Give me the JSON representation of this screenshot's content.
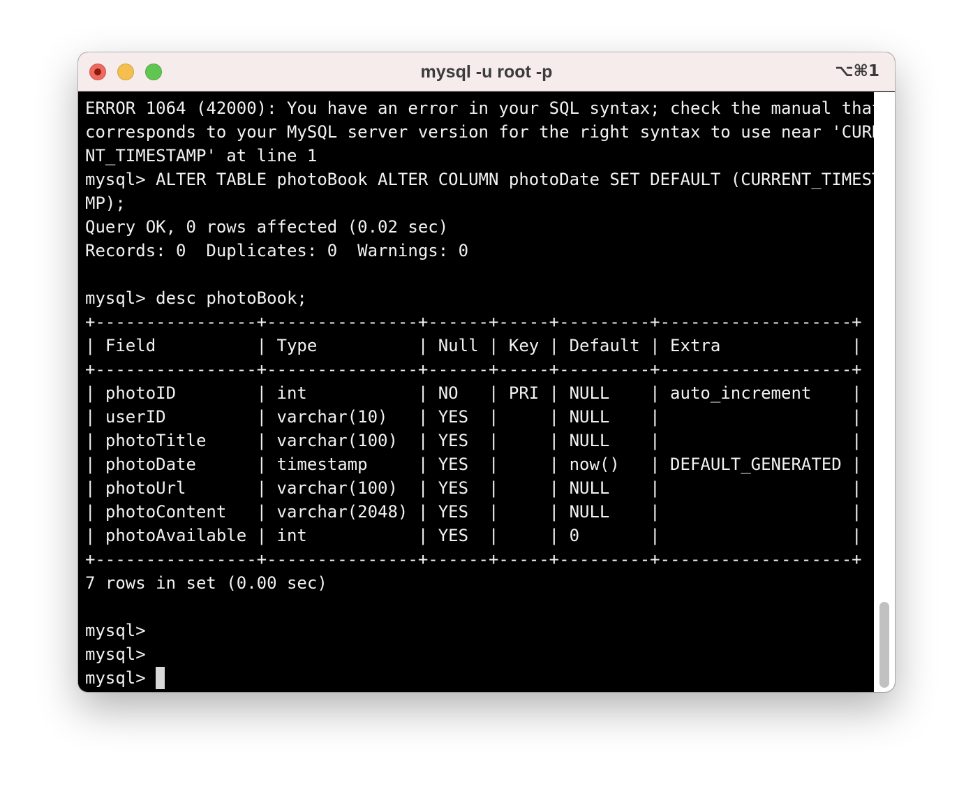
{
  "window": {
    "title": "mysql -u root -p",
    "shortcut": "⌥⌘1",
    "traffic_lights": {
      "close": "#ed6a5e",
      "minimize": "#f5bf4f",
      "zoom": "#61c554"
    }
  },
  "terminal": {
    "background": "#000000",
    "foreground": "#f2f2f2",
    "lines": [
      "ERROR 1064 (42000): You have an error in your SQL syntax; check the manual that",
      "corresponds to your MySQL server version for the right syntax to use near 'CURRE",
      "NT_TIMESTAMP' at line 1",
      "mysql> ALTER TABLE photoBook ALTER COLUMN photoDate SET DEFAULT (CURRENT_TIMESTA",
      "MP);",
      "Query OK, 0 rows affected (0.02 sec)",
      "Records: 0  Duplicates: 0  Warnings: 0",
      "",
      "mysql> desc photoBook;",
      "+----------------+---------------+------+-----+---------+-------------------+",
      "| Field          | Type          | Null | Key | Default | Extra             |",
      "+----------------+---------------+------+-----+---------+-------------------+",
      "| photoID        | int           | NO   | PRI | NULL    | auto_increment    |",
      "| userID         | varchar(10)   | YES  |     | NULL    |                   |",
      "| photoTitle     | varchar(100)  | YES  |     | NULL    |                   |",
      "| photoDate      | timestamp     | YES  |     | now()   | DEFAULT_GENERATED |",
      "| photoUrl       | varchar(100)  | YES  |     | NULL    |                   |",
      "| photoContent   | varchar(2048) | YES  |     | NULL    |                   |",
      "| photoAvailable | int           | YES  |     | 0       |                   |",
      "+----------------+---------------+------+-----+---------+-------------------+",
      "7 rows in set (0.00 sec)",
      "",
      "mysql>",
      "mysql>"
    ],
    "prompt": "mysql>"
  }
}
